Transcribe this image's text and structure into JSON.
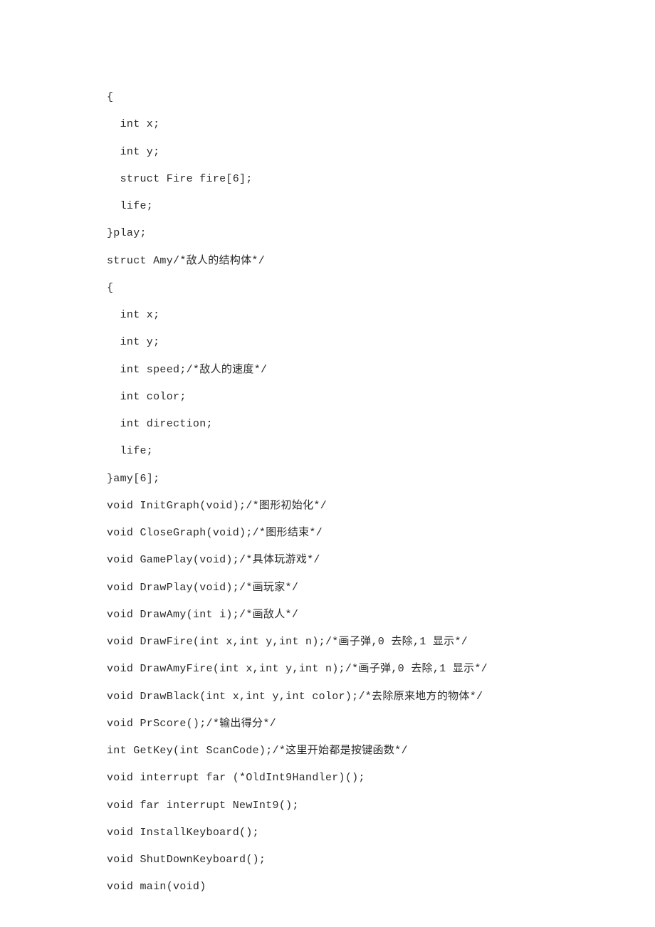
{
  "lines": [
    "{",
    "  int x;",
    "  int y;",
    "  struct Fire fire[6];",
    "  life;",
    "}play;",
    "struct Amy/*敌人的结构体*/",
    "{",
    "  int x;",
    "  int y;",
    "  int speed;/*敌人的速度*/",
    "  int color;",
    "  int direction;",
    "  life;",
    "}amy[6];",
    "void InitGraph(void);/*图形初始化*/",
    "void CloseGraph(void);/*图形结束*/",
    "void GamePlay(void);/*具体玩游戏*/",
    "void DrawPlay(void);/*画玩家*/",
    "void DrawAmy(int i);/*画敌人*/",
    "void DrawFire(int x,int y,int n);/*画子弹,0 去除,1 显示*/",
    "void DrawAmyFire(int x,int y,int n);/*画子弹,0 去除,1 显示*/",
    "void DrawBlack(int x,int y,int color);/*去除原来地方的物体*/",
    "void PrScore();/*输出得分*/",
    "int GetKey(int ScanCode);/*这里开始都是按键函数*/",
    "void interrupt far (*OldInt9Handler)();",
    "void far interrupt NewInt9();",
    "void InstallKeyboard();",
    "void ShutDownKeyboard();",
    "void main(void)"
  ]
}
